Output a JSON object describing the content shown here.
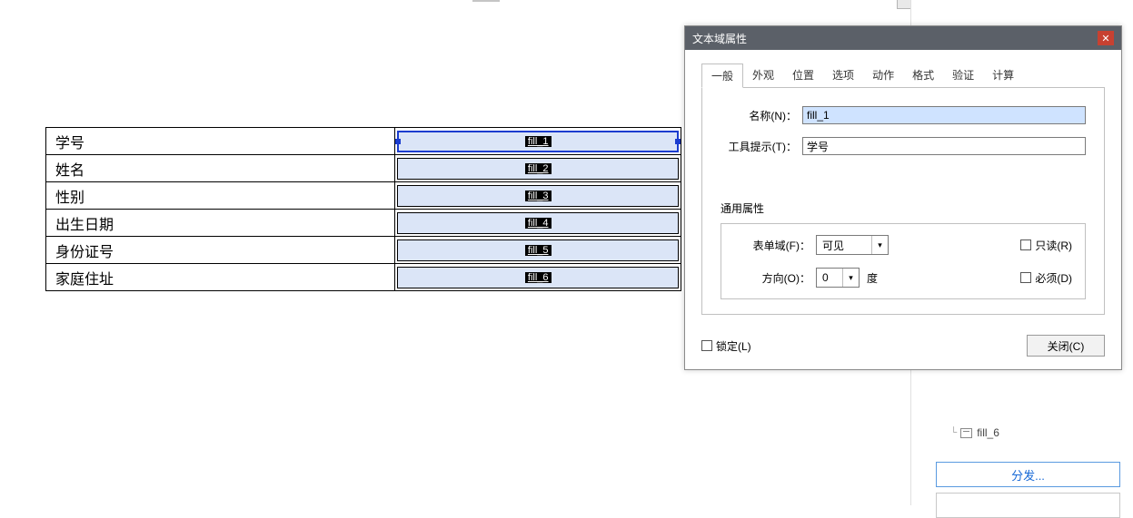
{
  "form": {
    "rows": [
      {
        "label": "学号",
        "field": "fill_1",
        "selected": true
      },
      {
        "label": "姓名",
        "field": "fill_2",
        "selected": false
      },
      {
        "label": "性别",
        "field": "fill_3",
        "selected": false
      },
      {
        "label": "出生日期",
        "field": "fill_4",
        "selected": false
      },
      {
        "label": "身份证号",
        "field": "fill_5",
        "selected": false
      },
      {
        "label": "家庭住址",
        "field": "fill_6",
        "selected": false
      }
    ]
  },
  "dialog": {
    "title": "文本域属性",
    "tabs": {
      "general": "一般",
      "appearance": "外观",
      "position": "位置",
      "options": "选项",
      "actions": "动作",
      "format": "格式",
      "validate": "验证",
      "calculate": "计算"
    },
    "general": {
      "name_label": "名称(N)：",
      "name_value": "fill_1",
      "tooltip_label": "工具提示(T)：",
      "tooltip_value": "学号",
      "common_title": "通用属性",
      "form_field_label": "表单域(F)：",
      "form_field_value": "可见",
      "orientation_label": "方向(O)：",
      "orientation_value": "0",
      "orientation_unit": "度",
      "readonly_label": "只读(R)",
      "required_label": "必须(D)"
    },
    "footer": {
      "lock_label": "锁定(L)",
      "close_label": "关闭(C)"
    }
  },
  "right_panel": {
    "tree_item": "fill_6",
    "distribute": "分发..."
  }
}
